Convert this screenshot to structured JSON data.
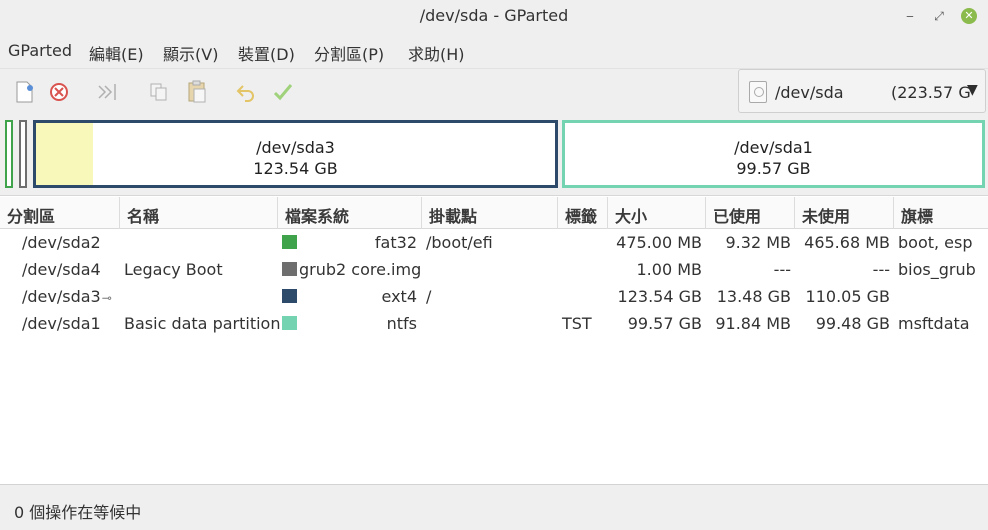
{
  "window": {
    "title": "/dev/sda - GParted"
  },
  "menu": [
    "GParted",
    "編輯(E)",
    "顯示(V)",
    "裝置(D)",
    "分割區(P)",
    "求助(H)"
  ],
  "toolbar": {
    "icons": [
      "new-icon",
      "delete-icon",
      "resize-move-icon",
      "copy-icon",
      "paste-icon",
      "undo-icon",
      "apply-icon"
    ]
  },
  "device_selector": {
    "device": "/dev/sda",
    "size": "(223.57 G"
  },
  "visual_map": {
    "sda3": {
      "name": "/dev/sda3",
      "size": "123.54 GB",
      "used_fraction": 0.109,
      "color": "#2e4a6b"
    },
    "sda1": {
      "name": "/dev/sda1",
      "size": "99.57 GB",
      "color": "#74d3b0"
    },
    "small_colors": [
      "#3ea34a",
      "#6e6e6e"
    ]
  },
  "columns": [
    "分割區",
    "名稱",
    "檔案系統",
    "掛載點",
    "標籤",
    "大小",
    "已使用",
    "未使用",
    "旗標"
  ],
  "partitions": [
    {
      "partition": "/dev/sda2",
      "name": "",
      "fs_color": "#3ea34a",
      "filesystem": "fat32",
      "mount": "/boot/efi",
      "label": "",
      "size": "475.00 MB",
      "used": "9.32 MB",
      "unused": "465.68 MB",
      "flags": "boot, esp"
    },
    {
      "partition": "/dev/sda4",
      "name": "Legacy Boot",
      "fs_color": "#6e6e6e",
      "filesystem": "grub2 core.img",
      "mount": "",
      "label": "",
      "size": "1.00 MB",
      "used": "---",
      "unused": "---",
      "flags": "bios_grub"
    },
    {
      "partition": "/dev/sda3",
      "name": "",
      "fs_color": "#2e4a6b",
      "filesystem": "ext4",
      "mount": "/",
      "label": "",
      "size": "123.54 GB",
      "used": "13.48 GB",
      "unused": "110.05 GB",
      "flags": ""
    },
    {
      "partition": "/dev/sda1",
      "name": "Basic data partition",
      "fs_color": "#74d3b0",
      "filesystem": "ntfs",
      "mount": "",
      "label": "TST",
      "size": "99.57 GB",
      "used": "91.84 MB",
      "unused": "99.48 GB",
      "flags": "msftdata"
    }
  ],
  "status": {
    "pending": "0 個操作在等候中"
  }
}
